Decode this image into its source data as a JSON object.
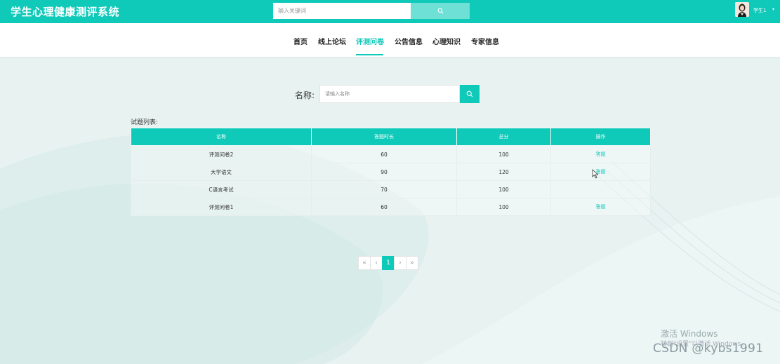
{
  "header": {
    "title": "学生心理健康测评系统",
    "search_placeholder": "输入关键词",
    "user_name": "学生1",
    "user_caret": "▾"
  },
  "nav": {
    "items": [
      {
        "label": "首页"
      },
      {
        "label": "线上论坛"
      },
      {
        "label": "评测问卷"
      },
      {
        "label": "公告信息"
      },
      {
        "label": "心理知识"
      },
      {
        "label": "专家信息"
      }
    ],
    "active_index": 2
  },
  "filter": {
    "name_label": "名称:",
    "name_placeholder": "请输入名称"
  },
  "table": {
    "caption": "试题列表:",
    "columns": [
      "名称",
      "答题时长",
      "总分",
      "操作"
    ],
    "rows": [
      {
        "name": "评测问卷2",
        "duration": "60",
        "score": "100",
        "op": "答题"
      },
      {
        "name": "大学语文",
        "duration": "90",
        "score": "120",
        "op": "答题"
      },
      {
        "name": "C语言考试",
        "duration": "70",
        "score": "100",
        "op": ""
      },
      {
        "name": "评测问卷1",
        "duration": "60",
        "score": "100",
        "op": "答题"
      }
    ]
  },
  "pagination": {
    "first": "«",
    "prev": "‹",
    "current": "1",
    "next": "›",
    "last": "»"
  },
  "watermarks": {
    "windows_line1": "激活 Windows",
    "windows_line2": "转到\"设置\"以激活 Windows。",
    "csdn": "CSDN @kybs1991"
  },
  "colors": {
    "accent": "#0fc9b9",
    "accent_light": "#6fe0d6",
    "background": "#e7f2f1"
  }
}
